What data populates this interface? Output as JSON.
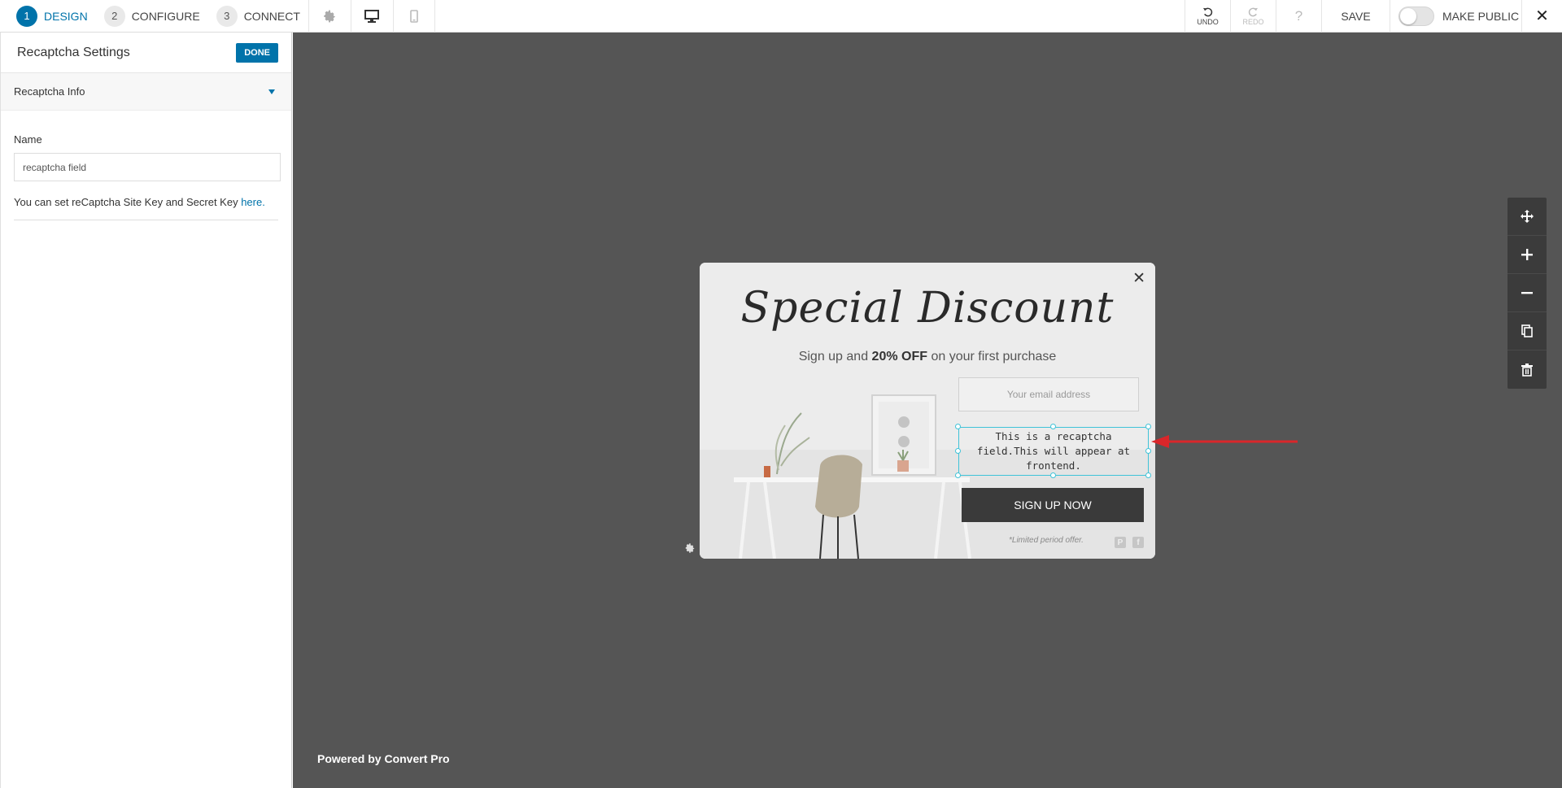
{
  "topbar": {
    "steps": [
      {
        "num": "1",
        "label": "DESIGN"
      },
      {
        "num": "2",
        "label": "CONFIGURE"
      },
      {
        "num": "3",
        "label": "CONNECT"
      }
    ],
    "icons": [
      "gear-icon",
      "desktop-icon",
      "mobile-icon"
    ],
    "undo_label": "UNDO",
    "redo_label": "REDO",
    "help_label": "?",
    "save_label": "SAVE",
    "public_label": "MAKE PUBLIC",
    "public_enabled": false,
    "close_label": "✕"
  },
  "sidebar": {
    "title": "Recaptcha Settings",
    "done_label": "DONE",
    "section_label": "Recaptcha Info",
    "name_label": "Name",
    "name_value": "recaptcha field",
    "help_text": "You can set reCaptcha Site Key and Secret Key",
    "help_link": "here."
  },
  "canvas": {
    "powered_by": "Powered by Convert Pro",
    "tools": [
      "move-icon",
      "zoom-in-icon",
      "zoom-out-icon",
      "duplicate-icon",
      "delete-icon"
    ]
  },
  "popup": {
    "close_label": "✕",
    "title": "Special Discount",
    "subtitle_pre": "Sign up and ",
    "subtitle_bold": "20% OFF",
    "subtitle_post": " on your first purchase",
    "email_placeholder": "Your email address",
    "recaptcha_text": "This is a recaptcha field.This will appear at frontend.",
    "button_label": "SIGN UP NOW",
    "offer_text": "*Limited period offer.",
    "social": [
      "P",
      "f"
    ]
  },
  "colors": {
    "accent": "#0073aa",
    "canvas_bg": "#555555",
    "selection": "#3fc3d8",
    "arrow": "#d9262a"
  }
}
